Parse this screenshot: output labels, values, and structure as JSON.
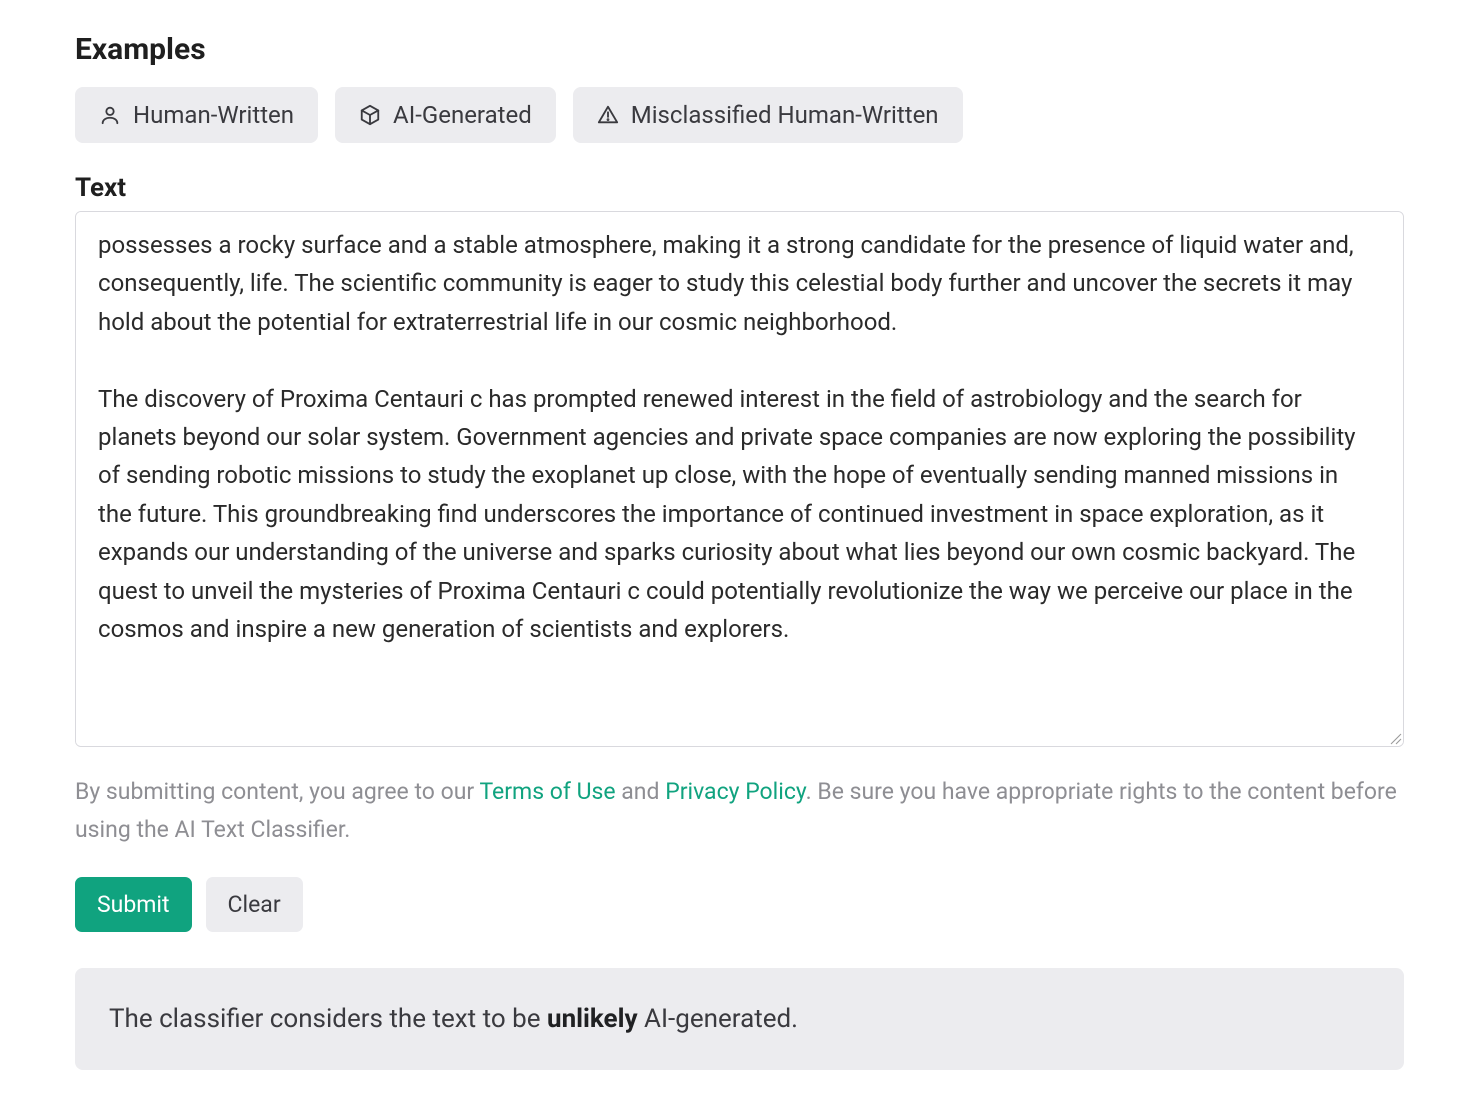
{
  "headings": {
    "examples": "Examples",
    "text": "Text"
  },
  "chips": {
    "human": "Human-Written",
    "ai": "AI-Generated",
    "misclassified": "Misclassified Human-Written"
  },
  "textarea": {
    "value": "possesses a rocky surface and a stable atmosphere, making it a strong candidate for the presence of liquid water and, consequently, life. The scientific community is eager to study this celestial body further and uncover the secrets it may hold about the potential for extraterrestrial life in our cosmic neighborhood.\n\nThe discovery of Proxima Centauri c has prompted renewed interest in the field of astrobiology and the search for planets beyond our solar system. Government agencies and private space companies are now exploring the possibility of sending robotic missions to study the exoplanet up close, with the hope of eventually sending manned missions in the future. This groundbreaking find underscores the importance of continued investment in space exploration, as it expands our understanding of the universe and sparks curiosity about what lies beyond our own cosmic backyard. The quest to unveil the mysteries of Proxima Centauri c could potentially revolutionize the way we perceive our place in the cosmos and inspire a new generation of scientists and explorers."
  },
  "legal": {
    "prefix": "By submitting content, you agree to our ",
    "terms": "Terms of Use",
    "and": " and ",
    "privacy": "Privacy Policy",
    "suffix": ". Be sure you have appropriate rights to the content before using the AI Text Classifier."
  },
  "buttons": {
    "submit": "Submit",
    "clear": "Clear"
  },
  "result": {
    "prefix": "The classifier considers the text to be ",
    "verdict": "unlikely",
    "suffix": " AI-generated."
  }
}
